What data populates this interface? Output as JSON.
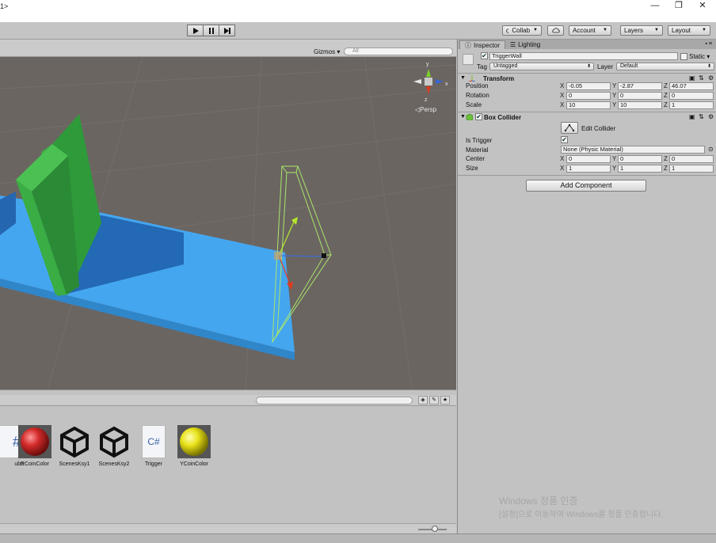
{
  "window": {
    "title": "1>",
    "controls": {
      "minimize": "—",
      "maximize": "❐",
      "close": "✕"
    }
  },
  "toolbar": {
    "play_icon": "play-icon",
    "pause_icon": "pause-icon",
    "step_icon": "step-icon",
    "collab": "Collab",
    "account": "Account",
    "layers": "Layers",
    "layout": "Layout"
  },
  "scene": {
    "gizmos": "Gizmos",
    "search_placeholder": "All",
    "persp": "Persp",
    "gizmo_axes": {
      "y": "y",
      "x": "x",
      "z": "z"
    },
    "colors": {
      "background": "#6b6561",
      "ground": "#45a6f0",
      "wall": "#3cab44",
      "trigger_wire": "#a8e66a"
    }
  },
  "project": {
    "assets": [
      {
        "label": "ube",
        "kind": "script-partial"
      },
      {
        "label": "RCoinColor",
        "kind": "red-material"
      },
      {
        "label": "ScenesKsy1",
        "kind": "unity-scene"
      },
      {
        "label": "ScenesKsy2",
        "kind": "unity-scene"
      },
      {
        "label": "Trigger",
        "kind": "csharp-script"
      },
      {
        "label": "YCoinColor",
        "kind": "yellow-material"
      }
    ],
    "csharp_glyph": "C#",
    "partial_glyph": "#"
  },
  "inspector": {
    "tabs": [
      "Inspector",
      "Lighting"
    ],
    "object": {
      "name": "TriggerWall",
      "static_label": "Static",
      "tag_label": "Tag",
      "tag_value": "Untagged",
      "layer_label": "Layer",
      "layer_value": "Default"
    },
    "transform": {
      "title": "Transform",
      "rows": [
        {
          "label": "Position",
          "x": "-0.05",
          "y": "-2.87",
          "z": "46.07"
        },
        {
          "label": "Rotation",
          "x": "0",
          "y": "0",
          "z": "0"
        },
        {
          "label": "Scale",
          "x": "10",
          "y": "10",
          "z": "1"
        }
      ]
    },
    "box_collider": {
      "title": "Box Collider",
      "edit_collider": "Edit Collider",
      "is_trigger": "Is Trigger",
      "material_label": "Material",
      "material_value": "None (Physic Material)",
      "center": {
        "label": "Center",
        "x": "0",
        "y": "0",
        "z": "0"
      },
      "size": {
        "label": "Size",
        "x": "1",
        "y": "1",
        "z": "1"
      }
    },
    "add_component": "Add Component"
  },
  "watermark": {
    "line1": "Windows 정품 인증",
    "line2": "[설정]으로 이동하여 Windows를 정품 인증합니다."
  }
}
